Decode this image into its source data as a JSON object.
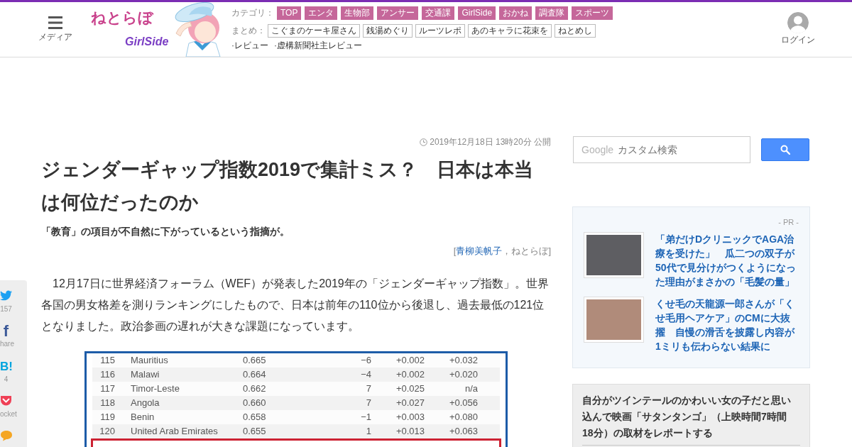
{
  "header": {
    "menu": {
      "label": "メディア"
    },
    "logo": {
      "title": "ねとらぼ",
      "subtitle": "GirlSide"
    },
    "categories": {
      "label": "カテゴリ：",
      "items": [
        "TOP",
        "エンタ",
        "生物部",
        "アンサー",
        "交通課",
        "GirlSide",
        "おかね",
        "調査隊",
        "スポーツ"
      ]
    },
    "collections": {
      "label": "まとめ：",
      "items": [
        "こぐまのケーキ屋さん",
        "銭湯めぐり",
        "ルーツレポ",
        "あのキャラに花束を",
        "ねとめし"
      ]
    },
    "reviews": [
      "·レビュー",
      "·虚構新聞社主レビュー"
    ],
    "login": {
      "label": "ログイン"
    }
  },
  "share_bar": [
    {
      "kind": "twitter",
      "count": "157"
    },
    {
      "kind": "facebook",
      "logo": "f",
      "count": "hare"
    },
    {
      "kind": "hatena",
      "logo": "B!",
      "count": "4"
    },
    {
      "kind": "pocket",
      "count": "ocket"
    },
    {
      "kind": "comment"
    }
  ],
  "article": {
    "published": "2019年12月18日 13時20分 公開",
    "title": "ジェンダーギャップ指数2019で集計ミス？　日本は本当は何位だったのか",
    "lead": "「教育」の項目が不自然に下がっているという指摘が。",
    "byline": {
      "open": "[",
      "author": "青柳美帆子",
      "rest": "，ねとらぼ]"
    },
    "body": "12月17日に世界経済フォーラム（WEF）が発表した2019年の「ジェンダーギャップ指数」。世界各国の男女格差を測りランキングにしたもので、日本は前年の110位から後退し、過去最低の121位となりました。政治参画の遅れが大きな課題になっています。",
    "table": {
      "rows": [
        {
          "cells": [
            "115",
            "Mauritius",
            "0.665",
            "−6",
            "+0.002",
            "+0.032"
          ],
          "highlighted": false
        },
        {
          "cells": [
            "116",
            "Malawi",
            "0.664",
            "−4",
            "+0.002",
            "+0.020"
          ],
          "highlighted": false
        },
        {
          "cells": [
            "117",
            "Timor-Leste",
            "0.662",
            "7",
            "+0.025",
            "n/a"
          ],
          "highlighted": false
        },
        {
          "cells": [
            "118",
            "Angola",
            "0.660",
            "7",
            "+0.027",
            "+0.056"
          ],
          "highlighted": false
        },
        {
          "cells": [
            "119",
            "Benin",
            "0.658",
            "−1",
            "+0.003",
            "+0.080"
          ],
          "highlighted": false
        },
        {
          "cells": [
            "120",
            "United Arab Emirates",
            "0.655",
            "1",
            "+0.013",
            "+0.063"
          ],
          "highlighted": false
        },
        {
          "highlighted": true
        }
      ]
    }
  },
  "sidebar": {
    "search": {
      "brand": "Google",
      "placeholder": "カスタム検索"
    },
    "pr": {
      "label": "- PR -",
      "items": [
        {
          "title": "「弟だけDクリニックでAGA治療を受けた」　瓜二つの双子が50代で見分けがつくようになった理由がまさかの「毛髪の量」"
        },
        {
          "title": "くせ毛の天龍源一郎さんが「くせ毛用ヘアケア」のCMに大抜擢　自慢の滑舌を披露し内容が1ミリも伝わらない結果に"
        }
      ]
    },
    "ranking": {
      "items": [
        {
          "title": "自分がツインテールのかわいい女の子だと思い込んで映画「サタンタンゴ」（上映時間7時間18分）の取材をレポートする"
        }
      ]
    }
  }
}
